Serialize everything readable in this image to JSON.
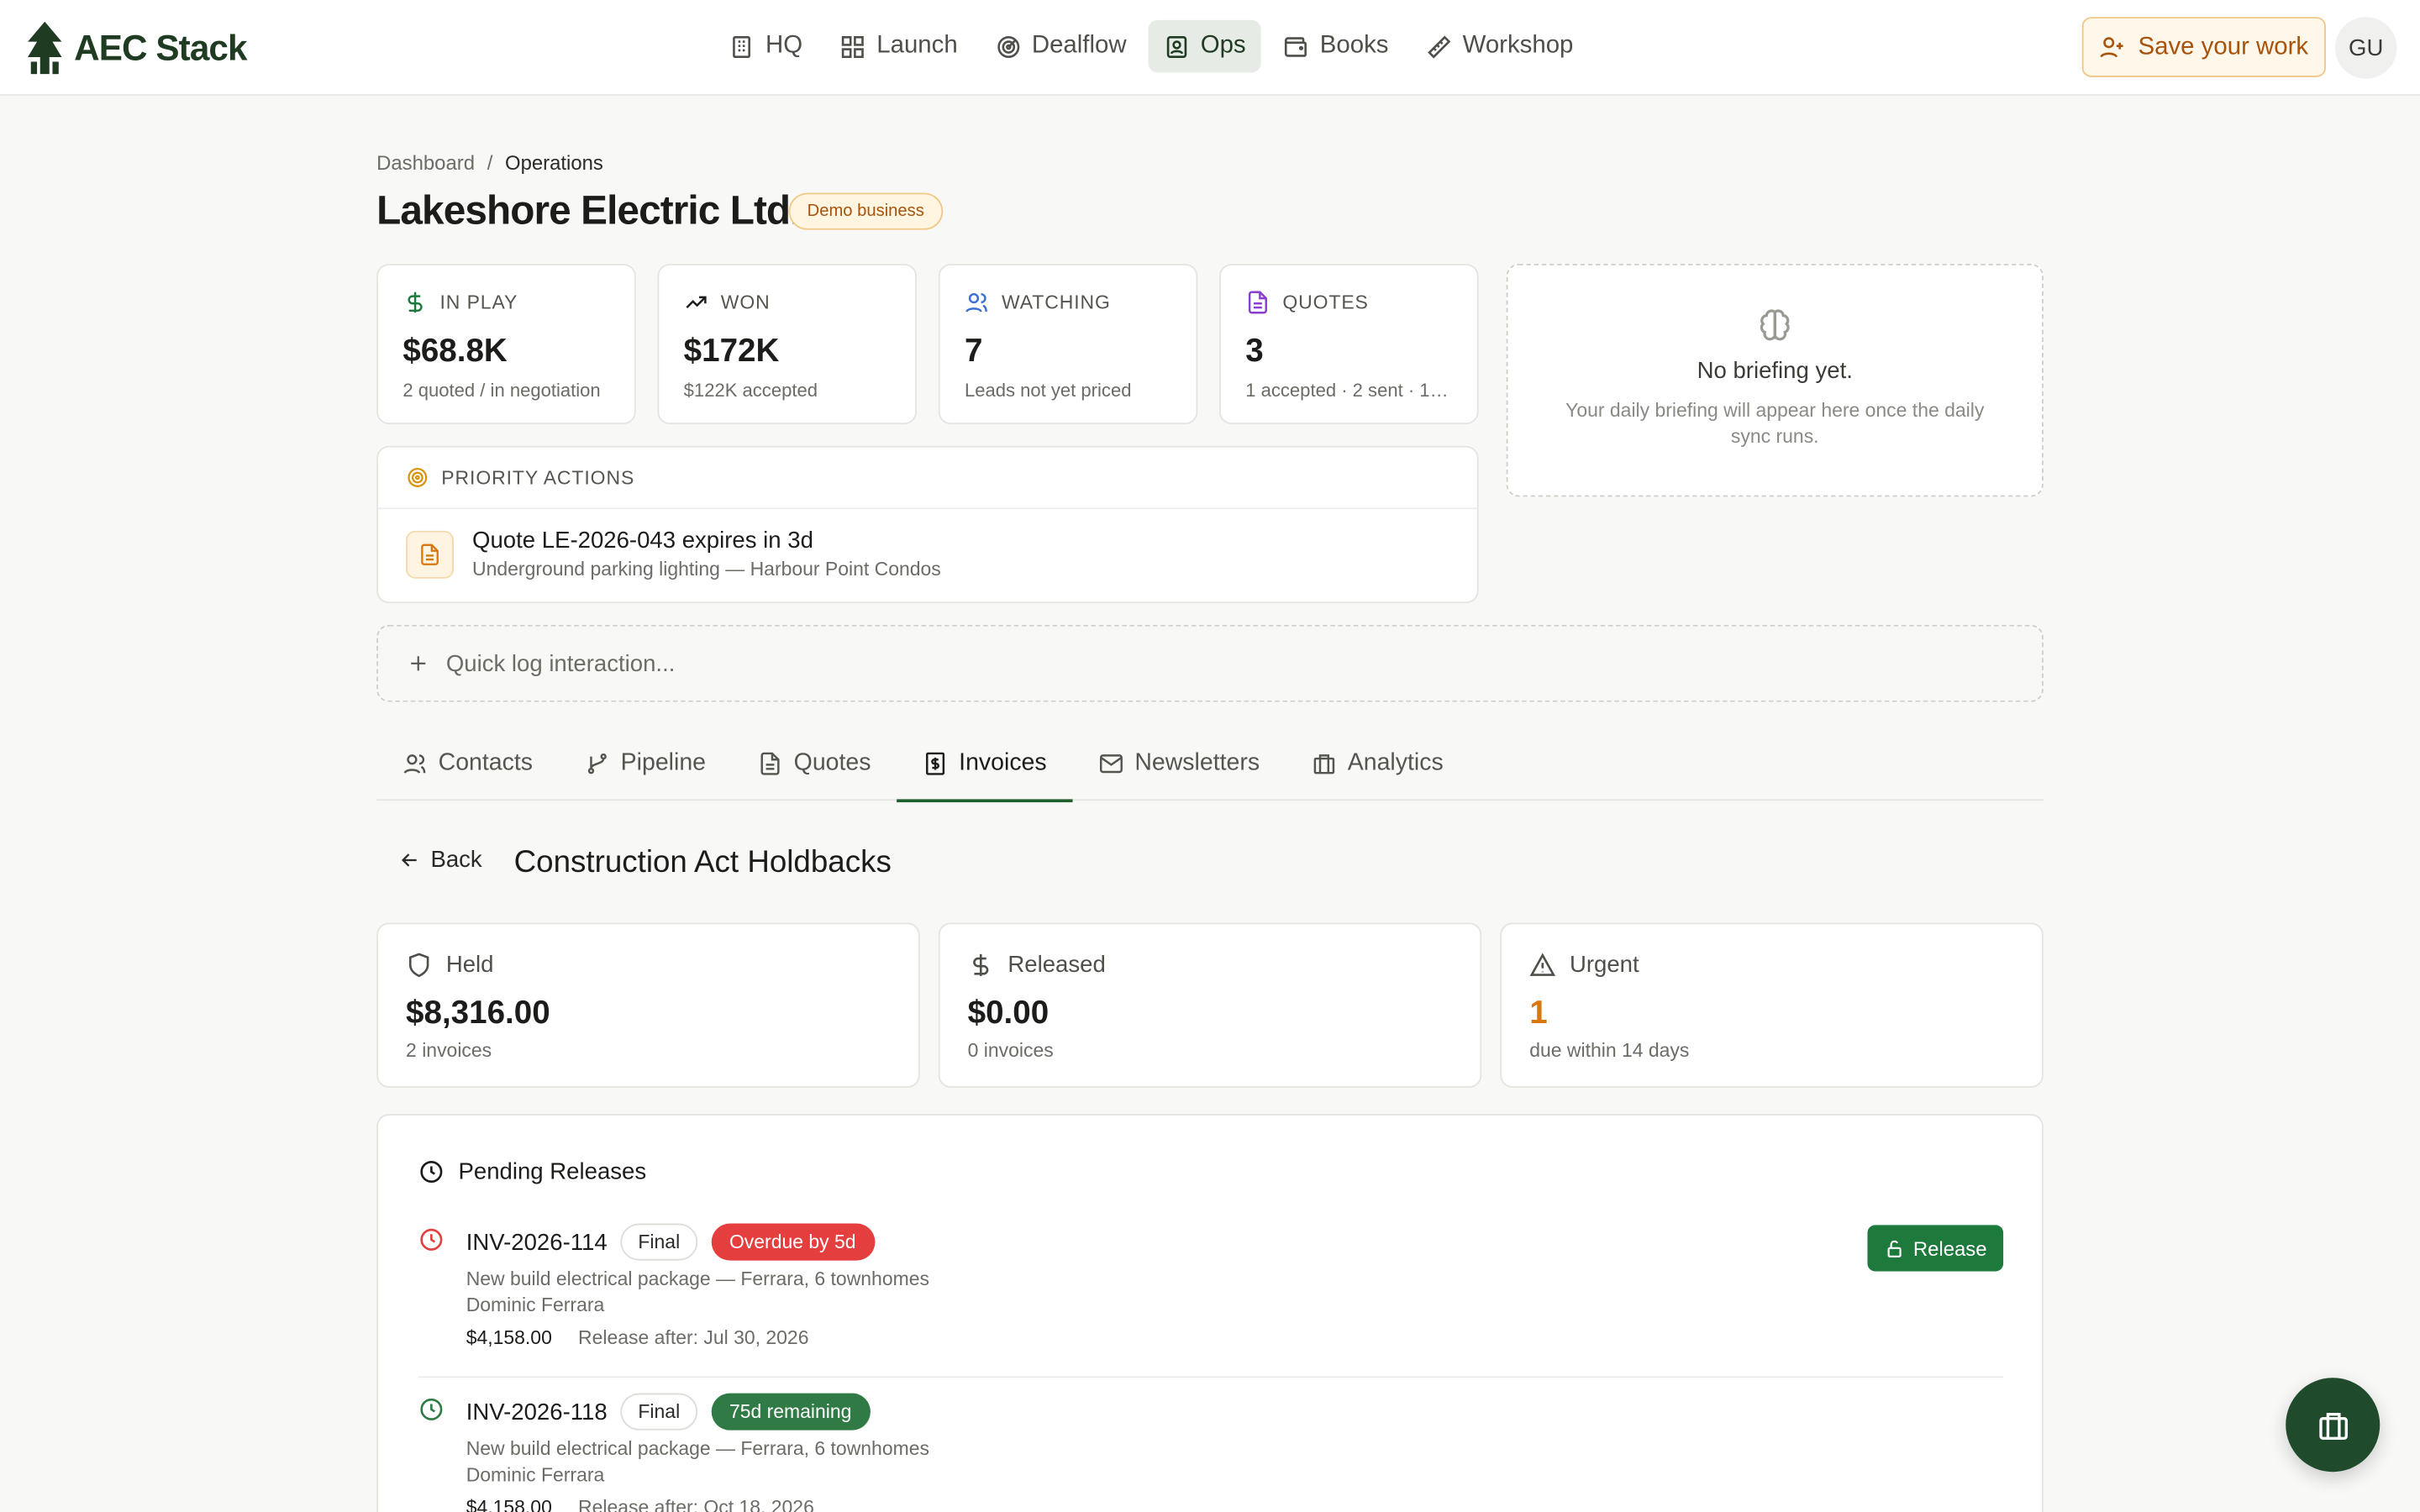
{
  "brand": {
    "name": "AEC Stack"
  },
  "nav": {
    "items": [
      {
        "label": "HQ",
        "icon": "building-icon"
      },
      {
        "label": "Launch",
        "icon": "grid-icon"
      },
      {
        "label": "Dealflow",
        "icon": "radar-icon"
      },
      {
        "label": "Ops",
        "icon": "contact-badge-icon",
        "active": true
      },
      {
        "label": "Books",
        "icon": "wallet-icon"
      },
      {
        "label": "Workshop",
        "icon": "ruler-icon"
      }
    ],
    "save_label": "Save your work",
    "avatar_initials": "GU"
  },
  "breadcrumb": {
    "root": "Dashboard",
    "separator": "/",
    "current": "Operations"
  },
  "page": {
    "title": "Lakeshore Electric Ltd.",
    "badge": "Demo business"
  },
  "stats": [
    {
      "label": "IN PLAY",
      "value": "$68.8K",
      "sub": "2 quoted / in negotiation",
      "icon": "dollar-icon",
      "color": "#1e7a3c"
    },
    {
      "label": "WON",
      "value": "$172K",
      "sub": "$122K accepted",
      "icon": "trending-up-icon",
      "color": "#1c1c1a"
    },
    {
      "label": "WATCHING",
      "value": "7",
      "sub": "Leads not yet priced",
      "icon": "users-icon",
      "color": "#3b6fd4"
    },
    {
      "label": "QUOTES",
      "value": "3",
      "sub": "1 accepted · 2 sent · 1 d...",
      "icon": "file-icon",
      "color": "#8a3fd1"
    }
  ],
  "briefing": {
    "title": "No briefing yet.",
    "text": "Your daily briefing will appear here once the daily sync runs."
  },
  "priority": {
    "header": "PRIORITY ACTIONS",
    "items": [
      {
        "title": "Quote LE-2026-043 expires in 3d",
        "sub": "Underground parking lighting — Harbour Point Condos"
      }
    ]
  },
  "quicklog": {
    "placeholder": "Quick log interaction..."
  },
  "tabs": [
    {
      "label": "Contacts",
      "icon": "users-icon"
    },
    {
      "label": "Pipeline",
      "icon": "git-branch-icon"
    },
    {
      "label": "Quotes",
      "icon": "file-icon"
    },
    {
      "label": "Invoices",
      "icon": "invoice-icon",
      "active": true
    },
    {
      "label": "Newsletters",
      "icon": "mail-icon"
    },
    {
      "label": "Analytics",
      "icon": "briefcase-icon"
    }
  ],
  "holdbacks": {
    "back_label": "Back",
    "title": "Construction Act Holdbacks",
    "cards": [
      {
        "label": "Held",
        "value": "$8,316.00",
        "sub": "2 invoices",
        "icon": "shield-icon"
      },
      {
        "label": "Released",
        "value": "$0.00",
        "sub": "0 invoices",
        "icon": "dollar-icon"
      },
      {
        "label": "Urgent",
        "value": "1",
        "sub": "due within 14 days",
        "icon": "alert-triangle-icon"
      }
    ]
  },
  "releases": {
    "header": "Pending Releases",
    "rows": [
      {
        "invoice": "INV-2026-114",
        "type": "Final",
        "status": "Overdue by 5d",
        "status_color": "#e53e3e",
        "clock_color": "#e53e3e",
        "project": "New build electrical package — Ferrara, 6 townhomes",
        "client": "Dominic Ferrara",
        "amount": "$4,158.00",
        "release_after": "Release after: Jul 30, 2026",
        "action": "Release"
      },
      {
        "invoice": "INV-2026-118",
        "type": "Final",
        "status": "75d remaining",
        "status_color": "#2f7a45",
        "clock_color": "#2f7a45",
        "project": "New build electrical package — Ferrara, 6 townhomes",
        "client": "Dominic Ferrara",
        "amount": "$4,158.00",
        "release_after": "Release after: Oct 18, 2026"
      }
    ]
  },
  "fab": {
    "icon": "briefcase-icon"
  }
}
